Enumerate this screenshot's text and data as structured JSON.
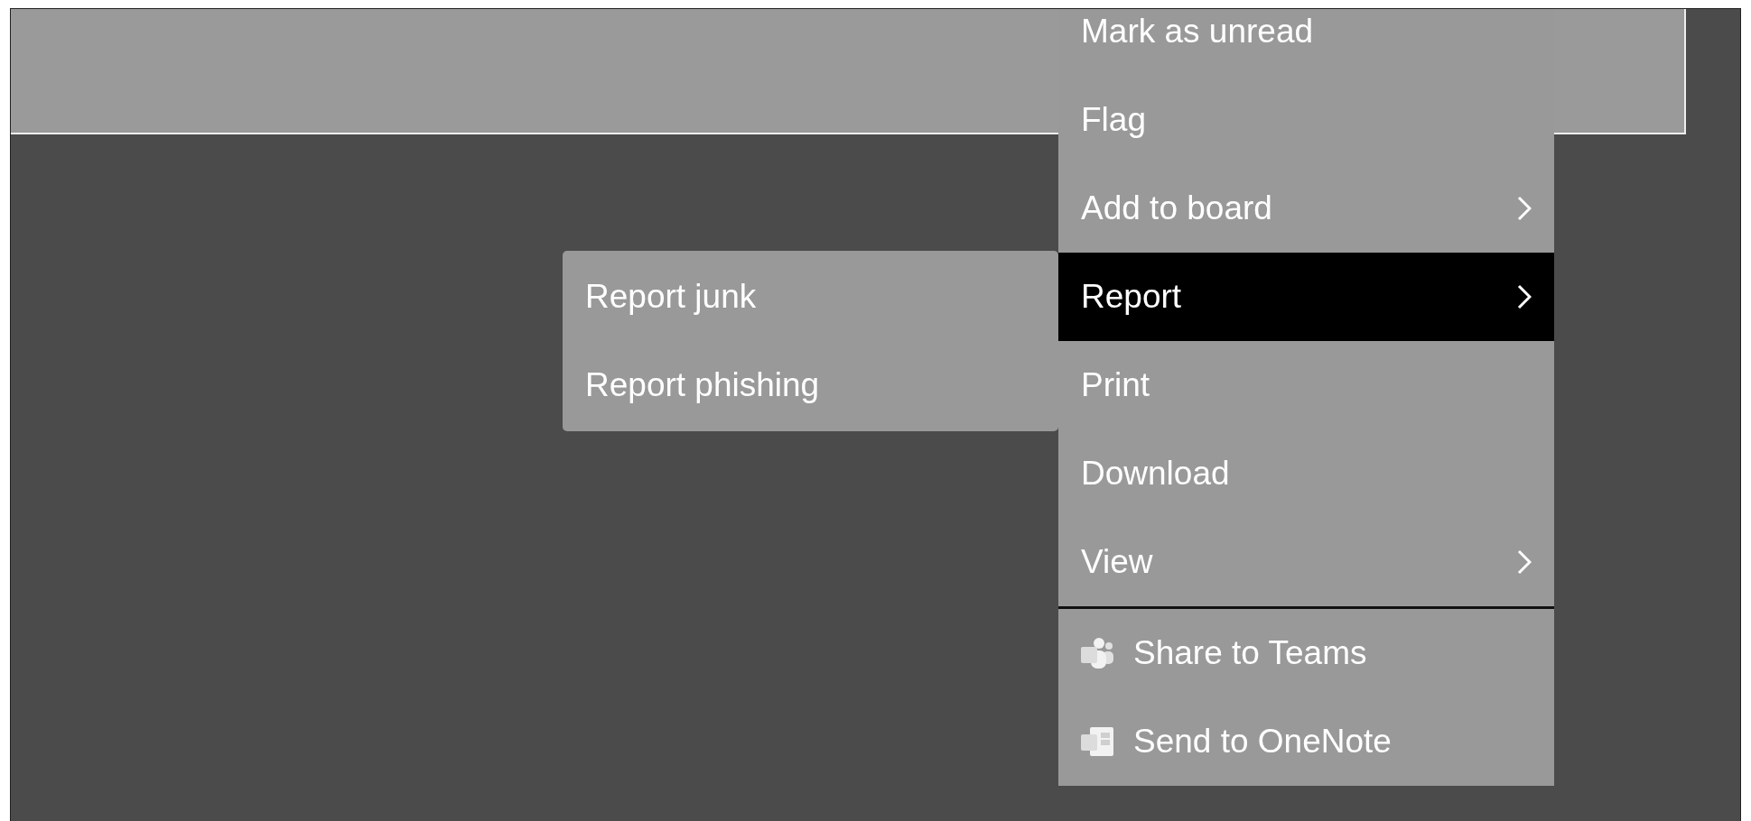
{
  "context_menu": {
    "items": [
      {
        "kind": "item",
        "label": "Mark as unread",
        "selected": false
      },
      {
        "kind": "item",
        "label": "Flag",
        "selected": false
      },
      {
        "kind": "submenu",
        "label": "Add to board",
        "selected": false
      },
      {
        "kind": "submenu",
        "label": "Report",
        "selected": true
      },
      {
        "kind": "item",
        "label": "Print",
        "selected": false
      },
      {
        "kind": "item",
        "label": "Download",
        "selected": false
      },
      {
        "kind": "submenu",
        "label": "View",
        "selected": false
      },
      {
        "kind": "divider"
      },
      {
        "kind": "app",
        "label": "Share to Teams",
        "selected": false
      },
      {
        "kind": "app",
        "label": "Send to OneNote",
        "selected": false
      }
    ]
  },
  "submenu": {
    "items": [
      {
        "label": "Report junk",
        "selected": false
      },
      {
        "label": "Report phishing",
        "selected": false
      }
    ]
  }
}
